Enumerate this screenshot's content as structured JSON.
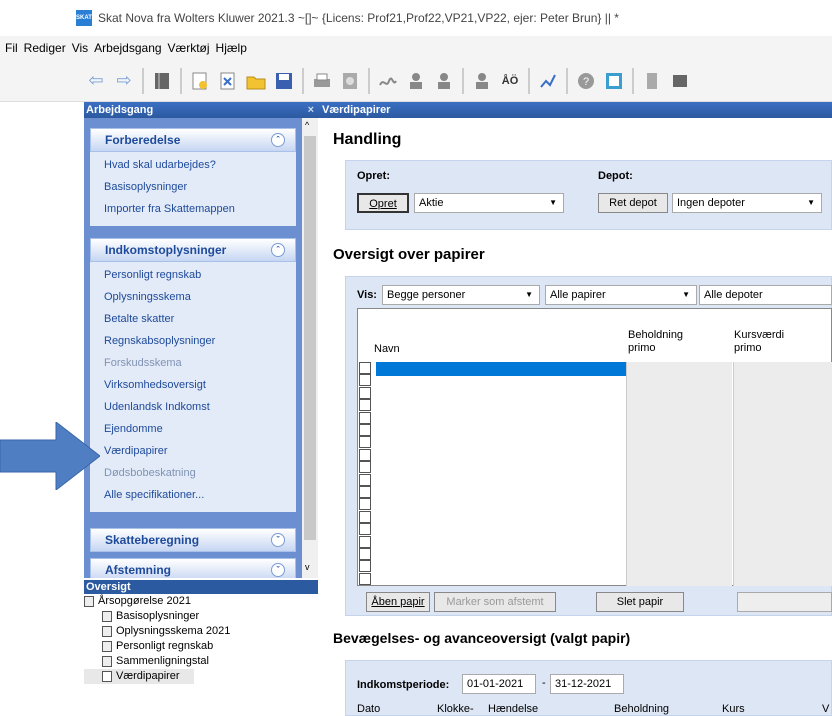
{
  "window": {
    "title": "Skat Nova fra Wolters Kluwer 2021.3  ~[]~  {Licens: Prof21,Prof22,VP21,VP22, ejer: Peter Brun}  || *",
    "app_icon": "SKAT"
  },
  "menu": [
    "Fil",
    "Rediger",
    "Vis",
    "Arbejdsgang",
    "Værktøj",
    "Hjælp"
  ],
  "toolbar": [
    "back-icon",
    "forward-icon",
    "book-icon",
    "new-doc-icon",
    "close-doc-icon",
    "open-folder-icon",
    "save-icon",
    "print-icon",
    "preview-icon",
    "signature-icon",
    "person-icon",
    "persons-icon",
    "person-add-icon",
    "ao-icon",
    "chart-icon",
    "help-icon",
    "calculator-icon",
    "stack-icon",
    "dark-stack-icon"
  ],
  "left": {
    "title": "Arbejdsgang",
    "close": "×",
    "groups": [
      {
        "title": "Forberedelse",
        "chev": "⌃",
        "items": [
          {
            "label": "Hvad skal udarbejdes?",
            "dim": false
          },
          {
            "label": "Basisoplysninger",
            "dim": false
          },
          {
            "label": "Importer fra Skattemappen",
            "dim": false
          }
        ]
      },
      {
        "title": "Indkomstoplysninger",
        "chev": "⌃",
        "items": [
          {
            "label": "Personligt regnskab",
            "dim": false
          },
          {
            "label": "Oplysningsskema",
            "dim": false
          },
          {
            "label": "Betalte skatter",
            "dim": false
          },
          {
            "label": "Regnskabsoplysninger",
            "dim": false
          },
          {
            "label": "Forskudsskema",
            "dim": true
          },
          {
            "label": "Virksomhedsoversigt",
            "dim": false
          },
          {
            "label": "Udenlandsk Indkomst",
            "dim": false
          },
          {
            "label": "Ejendomme",
            "dim": false
          },
          {
            "label": "Værdipapirer",
            "dim": false
          },
          {
            "label": "Dødsbobeskatning",
            "dim": true
          },
          {
            "label": "Alle specifikationer...",
            "dim": false
          }
        ]
      },
      {
        "title": "Skatteberegning",
        "chev": "⌄",
        "items": []
      },
      {
        "title": "Afstemning",
        "chev": "⌄",
        "items": []
      }
    ]
  },
  "oversigt": {
    "title": "Oversigt",
    "root": "Årsopgørelse 2021",
    "children": [
      "Basisoplysninger",
      "Oplysningsskema 2021",
      "Personligt regnskab",
      "Sammenligningstal",
      "Værdipapirer"
    ]
  },
  "main": {
    "title": "Værdipapirer",
    "handling": {
      "heading": "Handling",
      "opret_label": "Opret:",
      "opret_btn": "Opret",
      "opret_value": "Aktie",
      "depot_label": "Depot:",
      "ret_btn": "Ret depot",
      "depot_value": "Ingen depoter"
    },
    "oversigt": {
      "heading": "Oversigt over papirer",
      "vis_label": "Vis:",
      "filter_person": "Begge personer",
      "filter_papir": "Alle papirer",
      "filter_depot": "Alle depoter",
      "columns": [
        {
          "label": "Navn"
        },
        {
          "label": "Beholdning primo"
        },
        {
          "label": "Kursværdi primo"
        }
      ],
      "open_btn": "Åben papir",
      "mark_btn": "Marker som afstemt",
      "delete_btn": "Slet papir",
      "checkbox_count": 18
    },
    "bevaegelse": {
      "heading": "Bevægelses- og avanceoversigt (valgt papir)",
      "period_label": "Indkomstperiode:",
      "from": "01-01-2021",
      "sep": "-",
      "to": "31-12-2021",
      "columns": [
        "Dato",
        "Klokke-",
        "Hændelse",
        "Beholdning",
        "Kurs",
        "V"
      ]
    }
  }
}
